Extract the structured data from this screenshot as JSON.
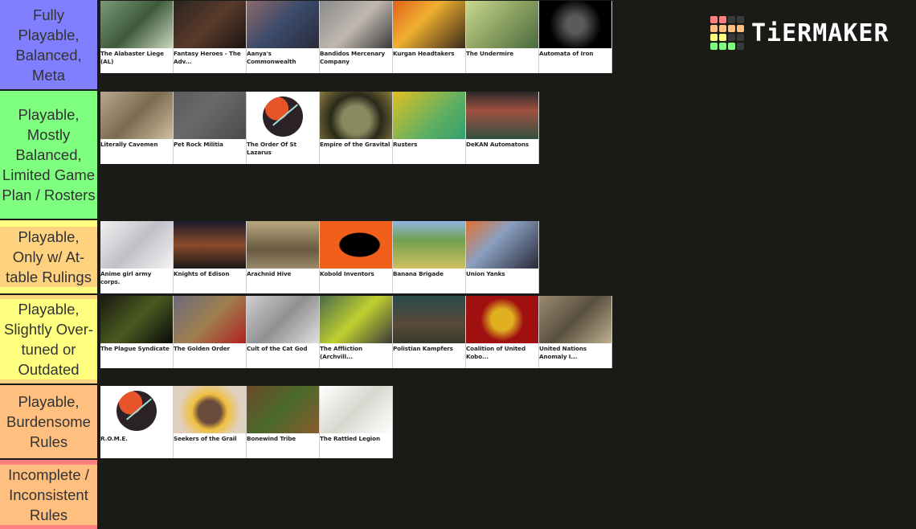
{
  "logo": {
    "text": "TiERMAKER",
    "grid_colors": [
      "#ff7f7f",
      "#ff7f7f",
      "#3a3a3a",
      "#3a3a3a",
      "#ffbf7f",
      "#ffbf7f",
      "#ffbf7f",
      "#ffbf7f",
      "#ffff7f",
      "#ffff7f",
      "#3a3a3a",
      "#3a3a3a",
      "#7fff7f",
      "#7fff7f",
      "#7fff7f",
      "#3a3a3a"
    ]
  },
  "tiers": [
    {
      "label": "Fully Playable, Balanced, Meta",
      "color": "#7f7fff",
      "highlight": null,
      "items": [
        {
          "name": "The Alabaster Liege (AL)",
          "bg": "linear-gradient(135deg,#7a9a7a,#3e5a3a 50%,#c9d6c0)"
        },
        {
          "name": "Fantasy Heroes - The Adv...",
          "bg": "linear-gradient(135deg,#2a2420,#5a3a2a 50%,#1a1412)"
        },
        {
          "name": "Aanya's Commonwealth",
          "bg": "linear-gradient(135deg,#8a6a6a,#3a4a6a 50%,#2a2a3a)"
        },
        {
          "name": "Bandidos Mercenary Company",
          "bg": "linear-gradient(135deg,#8a8a8a,#c0b8b0 50%,#3a3a3a)"
        },
        {
          "name": "Kurgan Headtakers",
          "bg": "linear-gradient(135deg,#e0601a,#f0b030 40%,#3a2a1a)"
        },
        {
          "name": "The Undermire",
          "bg": "linear-gradient(135deg,#c8d890,#8aa060 50%,#4a6a40)"
        },
        {
          "name": "Automata of Iron",
          "bg": "radial-gradient(circle at 50% 50%,#5a5a5a 0 20%,#000 60%)"
        }
      ]
    },
    {
      "label": "Playable, Mostly Balanced, Limited Game Plan / Rosters",
      "color": "#7fff7f",
      "highlight": null,
      "items": [
        {
          "name": "Literally Cavemen",
          "bg": "linear-gradient(135deg,#b8a890,#7a6a50 50%,#d0c0a0)"
        },
        {
          "name": "Pet Rock Militia",
          "bg": "linear-gradient(135deg,#5a5a5a,#6a6a6a 40%,#4a4a4a)"
        },
        {
          "name": "The Order Of St Lazarus",
          "bg": "circle"
        },
        {
          "name": "Empire of the Gravital",
          "bg": "radial-gradient(circle at 50% 60%,#8a8a60 0 30%,#2a2a1a 55%,#8a7a40)"
        },
        {
          "name": "Rusters",
          "bg": "linear-gradient(135deg,#e0c020,#60b060 60%,#30a070)"
        },
        {
          "name": "DeKAN Automatons",
          "bg": "linear-gradient(180deg,#2a2a2a,#a05040 40%,#305040)"
        }
      ]
    },
    {
      "label": "Playable, Only w/ At-table Rulings",
      "color": "#ffff7f",
      "highlight": "#ffd27f",
      "items": [
        {
          "name": "Anime girl army corps.",
          "bg": "linear-gradient(135deg,#f0f0f0,#c0c0c8 50%,#f4f4f4)"
        },
        {
          "name": "Knights of Edison",
          "bg": "linear-gradient(180deg,#1a1a2a,#8a4a2a 50%,#1a1a1a)"
        },
        {
          "name": "Arachnid Hive",
          "bg": "linear-gradient(180deg,#b8a880,#6a5a40 60%,#9a8a6a)"
        },
        {
          "name": "Kobold Inventors",
          "bg": "radial-gradient(ellipse at 55% 50%,#000 0 35%,#f0601a 37%)"
        },
        {
          "name": "Banana Brigade",
          "bg": "linear-gradient(180deg,#90b8e0,#70a050 40%,#d0c060)"
        },
        {
          "name": "Union Yanks",
          "bg": "linear-gradient(135deg,#e07030,#8aa0c0 40%,#2a2a3a)"
        }
      ]
    },
    {
      "label": "Playable, Slightly Over-tuned or Outdated",
      "color": "#ffd27f",
      "highlight": "#ffff7f",
      "items": [
        {
          "name": "The Plague Syndicate",
          "bg": "linear-gradient(135deg,#1a1a10,#4a5a20 50%,#0a0a08)"
        },
        {
          "name": "The Golden Order",
          "bg": "linear-gradient(135deg,#6a6a7a,#a08050 50%,#b02020)"
        },
        {
          "name": "Cult of the Cat God",
          "bg": "linear-gradient(135deg,#d0d0d0,#909090 50%,#e0e0e0)"
        },
        {
          "name": "The Affliction (Archvill...",
          "bg": "linear-gradient(135deg,#4a6a4a,#c0d030 50%,#3a3a3a)"
        },
        {
          "name": "Polistian Kampfers",
          "bg": "linear-gradient(180deg,#2a4a4a,#5a4a3a 60%,#3a3a2a)"
        },
        {
          "name": "Coalition of United Kobo...",
          "bg": "radial-gradient(circle at 50% 50%,#e0b020 0 25%,#a01010 50%)"
        },
        {
          "name": "United Nations Anomaly I...",
          "bg": "linear-gradient(135deg,#9a8a70,#5a5040 50%,#c0b090)"
        }
      ]
    },
    {
      "label": "Playable, Burdensome Rules",
      "color": "#ffbf7f",
      "highlight": null,
      "items": [
        {
          "name": "R.O.M.E.",
          "bg": "circle"
        },
        {
          "name": "Seekers of the Grail",
          "bg": "radial-gradient(circle at 50% 55%,#6a4a3a 0 25%,#f0c040 40%,#e0d0c0 70%)"
        },
        {
          "name": "Bonewind Tribe",
          "bg": "linear-gradient(135deg,#6a4a2a,#4a6a2a 50%,#8a5a30)"
        },
        {
          "name": "The Rattled Legion",
          "bg": "linear-gradient(135deg,#fff,#d8d8d0 50%,#fff)"
        }
      ]
    },
    {
      "label": "Incomplete / Inconsistent Rules",
      "color": "#ff7f7f",
      "highlight": "#ffbf7f",
      "items": []
    }
  ]
}
